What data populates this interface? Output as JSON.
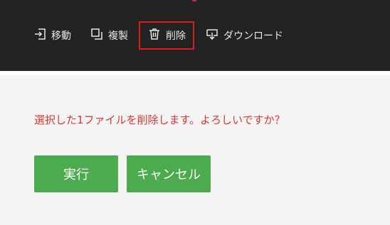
{
  "toolbar": {
    "move_label": "移動",
    "copy_label": "複製",
    "delete_label": "削除",
    "download_label": "ダウンロード",
    "move_icon": "move-icon",
    "copy_icon": "copy-icon",
    "delete_icon": "trash-icon",
    "download_icon": "download-icon"
  },
  "dialog": {
    "message": "選択した1ファイルを削除します。よろしいですか？",
    "execute_label": "実行",
    "cancel_label": "キャンセル"
  },
  "colors": {
    "toolbar_bg": "#232323",
    "page_bg": "#f4f4f4",
    "message_text": "#d23a34",
    "button_bg": "#4caa4f",
    "highlight_border": "#e01b1b"
  }
}
